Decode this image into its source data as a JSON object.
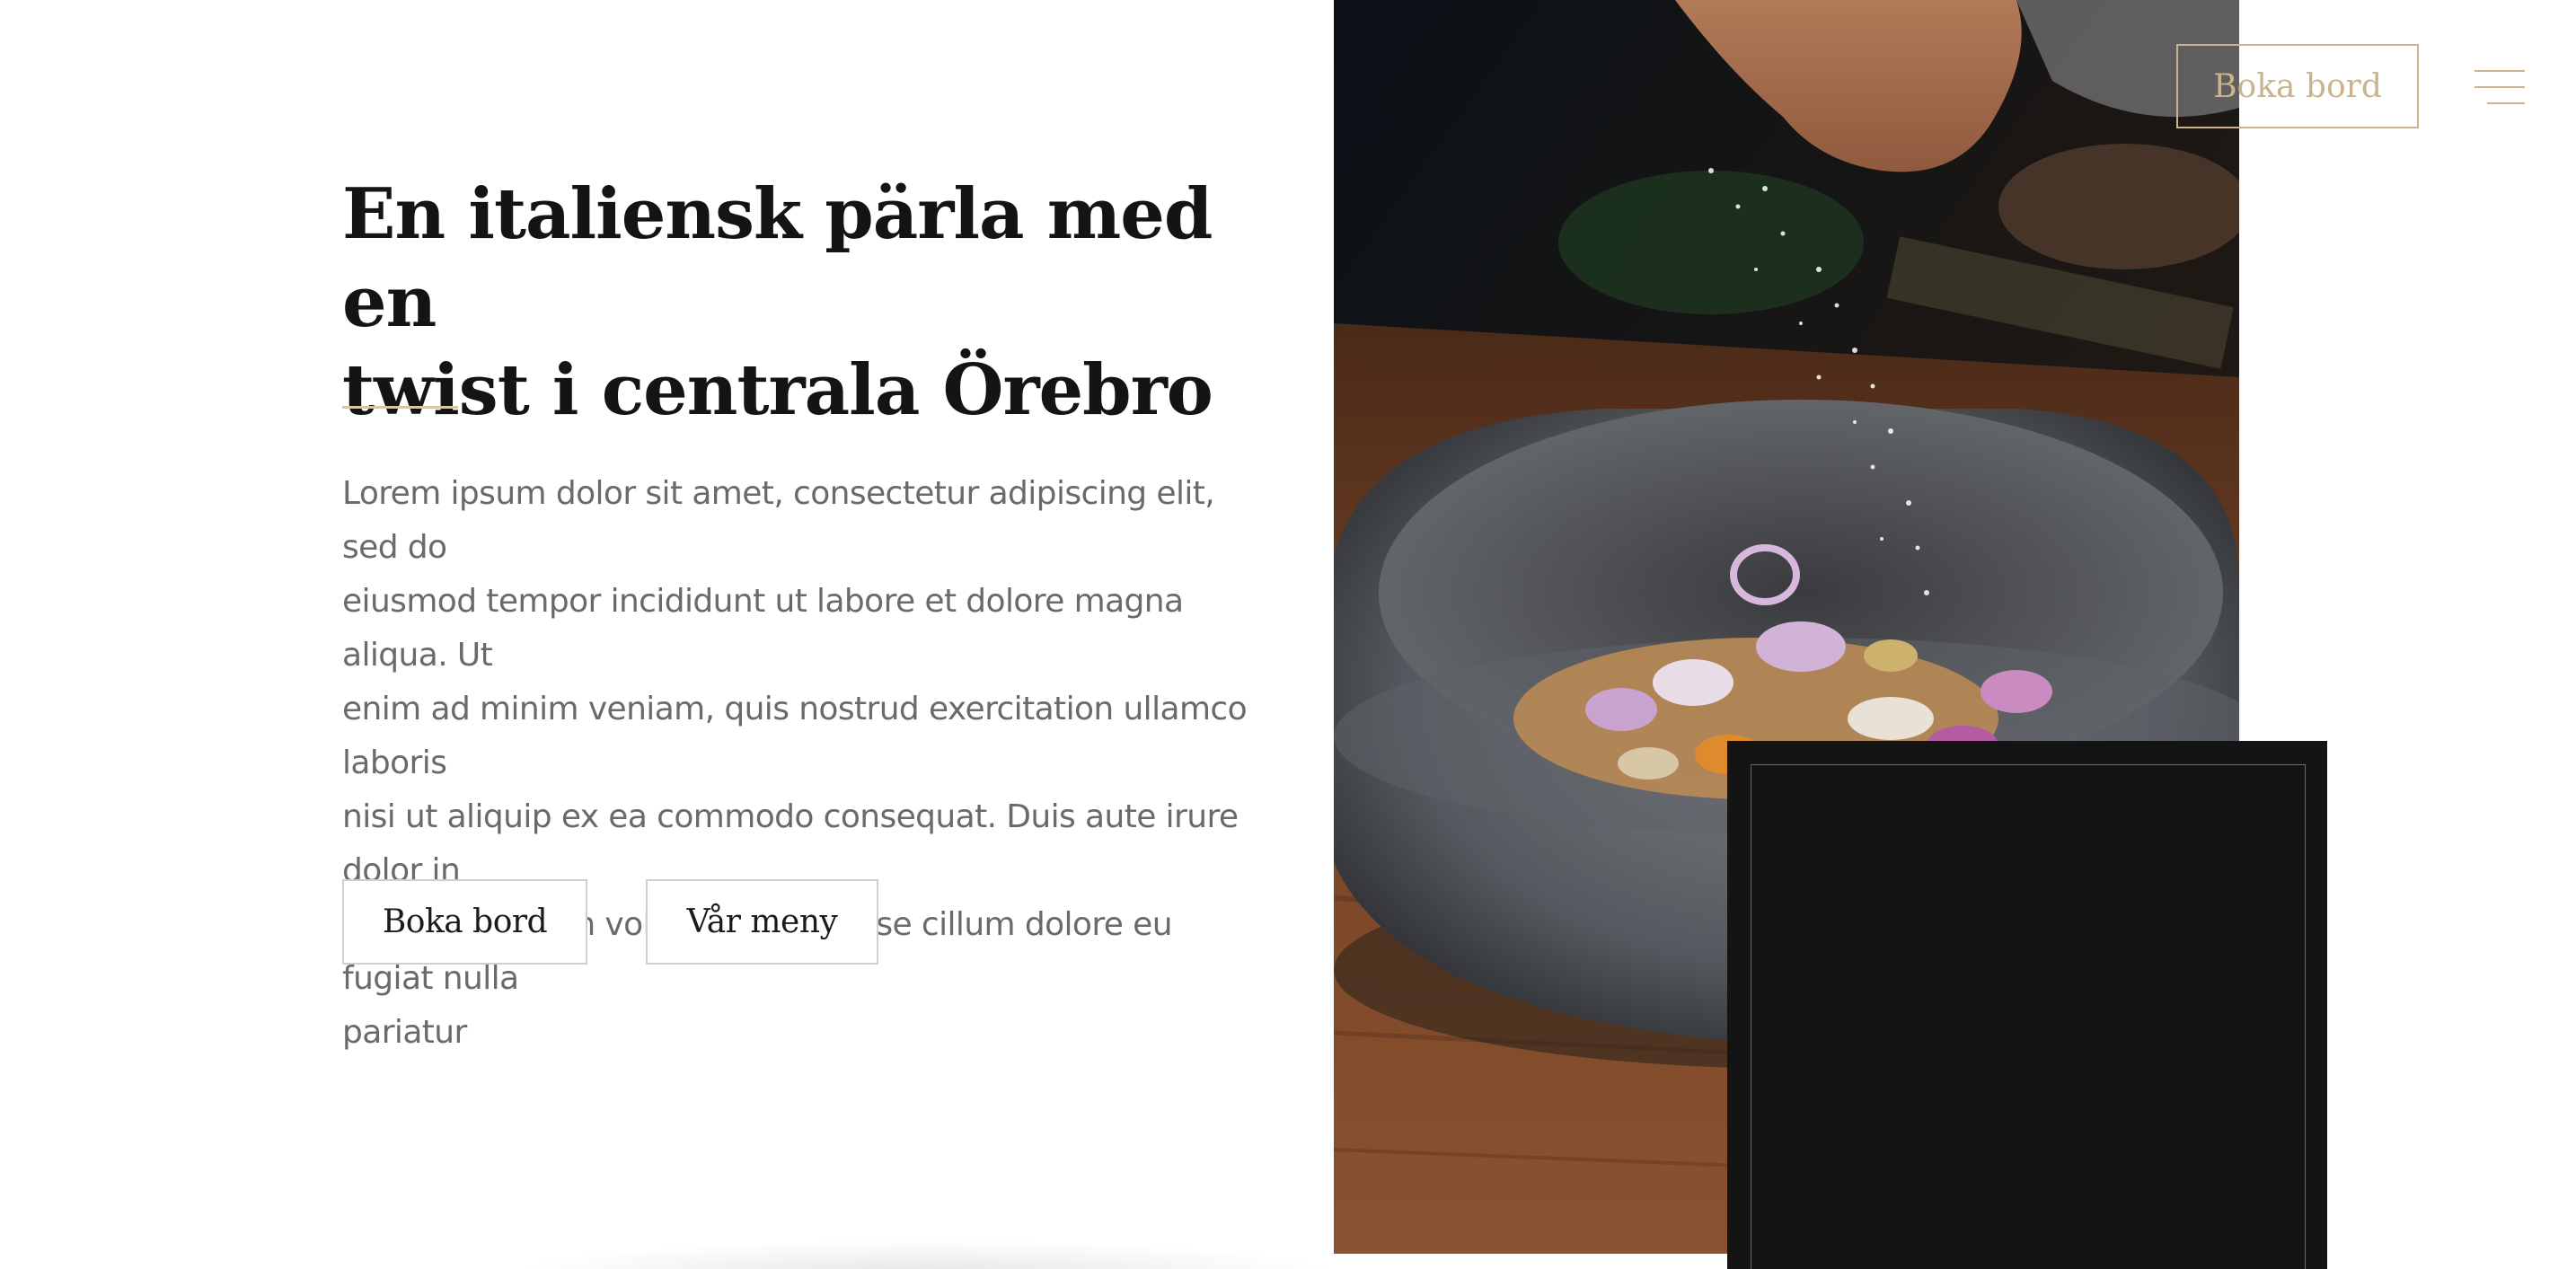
{
  "header": {
    "book_label": "Boka bord"
  },
  "hero": {
    "title_line1": "En italiensk pärla med en",
    "title_line2": "twist i centrala Örebro",
    "body_lines": [
      "Lorem ipsum dolor sit amet, consectetur adipiscing elit, sed do",
      "eiusmod tempor incididunt ut labore et dolore magna aliqua. Ut",
      "enim ad minim veniam, quis nostrud exercitation ullamco laboris",
      "nisi ut aliquip ex ea commodo consequat. Duis aute irure dolor in",
      "reprehenderit in voluptate velit esse cillum dolore eu fugiat nulla",
      "pariatur"
    ],
    "cta_book": "Boka bord",
    "cta_menu": "Vår meny"
  },
  "icons": {
    "menu": "hamburger-icon"
  },
  "colors": {
    "accent": "#c9b48e",
    "divider": "#d6c7a8",
    "heading": "#141414",
    "body_text": "#6a6a6a",
    "dark_panel": "#141414"
  }
}
